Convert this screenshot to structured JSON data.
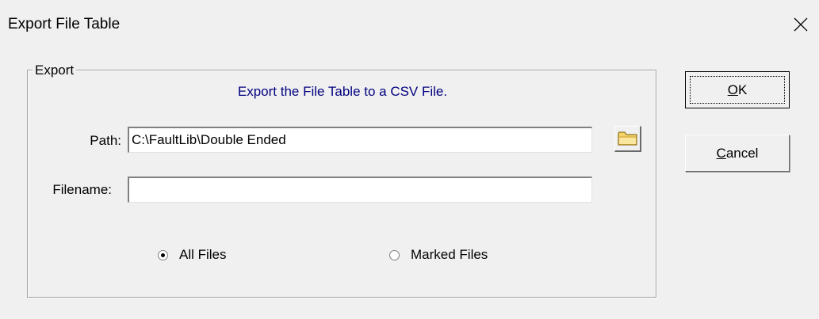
{
  "window": {
    "title": "Export File Table",
    "close_glyph": "✕"
  },
  "export_group": {
    "legend": "Export",
    "header": "Export the File Table to a CSV File.",
    "path_label": "Path:",
    "path_value": "C:\\FaultLib\\Double Ended",
    "filename_label": "Filename:",
    "filename_value": "",
    "browse_icon": "folder-icon",
    "radio_all": {
      "label": "All Files",
      "checked": true
    },
    "radio_marked": {
      "label": "Marked Files",
      "checked": false
    }
  },
  "buttons": {
    "ok_first": "O",
    "ok_rest": "K",
    "cancel_first": "C",
    "cancel_rest": "ancel"
  },
  "colors": {
    "header_text": "#000080",
    "folder_yellow": "#f5d46a"
  }
}
